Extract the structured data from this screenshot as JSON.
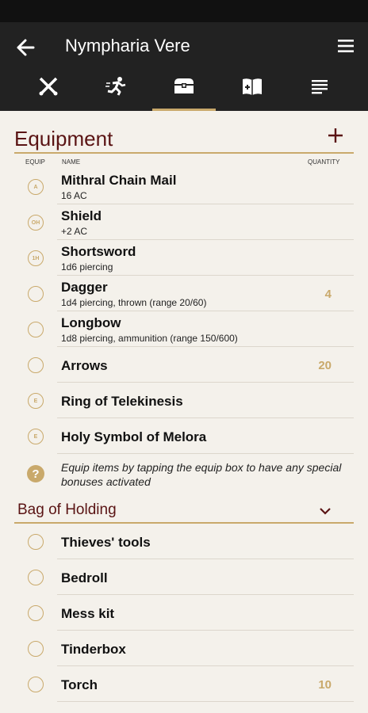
{
  "app": {
    "title": "Nympharia Vere"
  },
  "tabs": [
    {
      "name": "combat-tab",
      "icon": "crossed-swords-icon"
    },
    {
      "name": "skills-tab",
      "icon": "running-icon"
    },
    {
      "name": "inventory-tab",
      "icon": "chest-icon"
    },
    {
      "name": "spells-tab",
      "icon": "spellbook-icon"
    },
    {
      "name": "notes-tab",
      "icon": "notes-icon"
    }
  ],
  "equipment": {
    "title": "Equipment",
    "col_equip": "EQUIP",
    "col_name": "NAME",
    "col_quantity": "QUANTITY",
    "items": [
      {
        "badge": "A",
        "name": "Mithral Chain Mail",
        "sub": "16 AC",
        "qty": ""
      },
      {
        "badge": "OH",
        "name": "Shield",
        "sub": "+2 AC",
        "qty": ""
      },
      {
        "badge": "1H",
        "name": "Shortsword",
        "sub": "1d6 piercing",
        "qty": ""
      },
      {
        "badge": "",
        "name": "Dagger",
        "sub": "1d4 piercing, thrown (range 20/60)",
        "qty": "4"
      },
      {
        "badge": "",
        "name": "Longbow",
        "sub": "1d8 piercing, ammunition (range 150/600)",
        "qty": ""
      },
      {
        "badge": "",
        "name": "Arrows",
        "sub": "",
        "qty": "20"
      },
      {
        "badge": "E",
        "name": "Ring of Telekinesis",
        "sub": "",
        "qty": ""
      },
      {
        "badge": "E",
        "name": "Holy Symbol of Melora",
        "sub": "",
        "qty": ""
      }
    ],
    "hint": "Equip items by tapping the equip box to have any special bonuses activated"
  },
  "bag": {
    "title": "Bag of Holding",
    "items": [
      {
        "name": "Thieves' tools",
        "qty": ""
      },
      {
        "name": "Bedroll",
        "qty": ""
      },
      {
        "name": "Mess kit",
        "qty": ""
      },
      {
        "name": "Tinderbox",
        "qty": ""
      },
      {
        "name": "Torch",
        "qty": "10"
      }
    ]
  },
  "colors": {
    "accent": "#c9a96b",
    "header": "#5a1414",
    "appbar": "#222222"
  }
}
